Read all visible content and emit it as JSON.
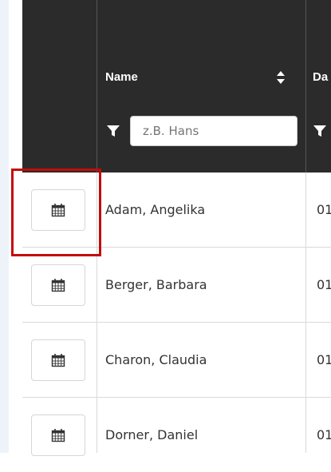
{
  "table": {
    "columns": [
      {
        "label": "",
        "icon": "calendar-icon"
      },
      {
        "label": "Name",
        "sort_icon": "sort-arrows-icon",
        "filter_icon": "filter-icon",
        "filter_placeholder": "z.B. Hans"
      },
      {
        "label": "Da",
        "filter_icon": "filter-icon"
      }
    ],
    "rows": [
      {
        "name": "Adam, Angelika",
        "date": "01"
      },
      {
        "name": "Berger, Barbara",
        "date": "01"
      },
      {
        "name": "Charon, Claudia",
        "date": "01"
      },
      {
        "name": "Dorner, Daniel",
        "date": "01"
      }
    ]
  },
  "colors": {
    "header_bg": "#2b2b2b",
    "highlight": "#c40a0a"
  }
}
